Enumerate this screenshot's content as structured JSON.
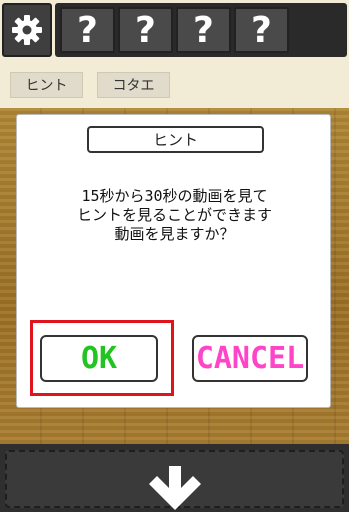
{
  "toolbar": {
    "settings_icon": "gear-icon",
    "slots": [
      "?",
      "?",
      "?",
      "?"
    ]
  },
  "tabs": {
    "hint_label": "ヒント",
    "answer_label": "コタエ"
  },
  "dialog": {
    "title": "ヒント",
    "message_lines": [
      "15秒から30秒の動画を見て",
      "ヒントを見ることができます",
      "動画を見ますか？"
    ],
    "ok_label": "OK",
    "cancel_label": "CANCEL"
  },
  "bottom": {
    "icon": "arrow-down-icon"
  },
  "colors": {
    "ok_text": "#22c422",
    "cancel_text": "#ff44c8",
    "highlight_border": "#e0141c",
    "wood": "#a77a2c"
  }
}
